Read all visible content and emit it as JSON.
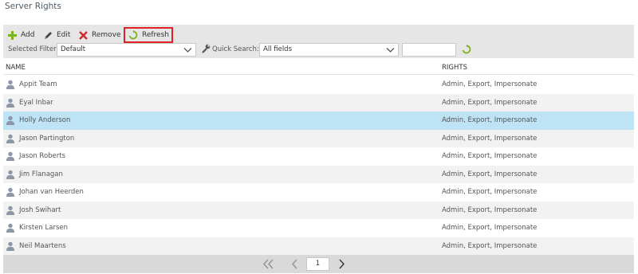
{
  "page_title": "Server Rights",
  "toolbar": {
    "add_label": "Add",
    "edit_label": "Edit",
    "remove_label": "Remove",
    "refresh_label": "Refresh",
    "selected_filter_label": "Selected Filter:",
    "selected_filter_value": "Default",
    "quick_search_label": "Quick Search:",
    "quick_search_field": "All fields",
    "quick_search_text": ""
  },
  "grid": {
    "columns": [
      "NAME",
      "RIGHTS"
    ],
    "rows": [
      {
        "name": "Appit Team",
        "rights": "Admin, Export, Impersonate"
      },
      {
        "name": "Eyal Inbar",
        "rights": "Admin, Export, Impersonate"
      },
      {
        "name": "Holly Anderson",
        "rights": "Admin, Export, Impersonate"
      },
      {
        "name": "Jason Partington",
        "rights": "Admin, Export, Impersonate"
      },
      {
        "name": "Jason Roberts",
        "rights": "Admin, Export, Impersonate"
      },
      {
        "name": "Jim Flanagan",
        "rights": "Admin, Export, Impersonate"
      },
      {
        "name": "Johan van Heerden",
        "rights": "Admin, Export, Impersonate"
      },
      {
        "name": "Josh Swihart",
        "rights": "Admin, Export, Impersonate"
      },
      {
        "name": "Kirsten Larsen",
        "rights": "Admin, Export, Impersonate"
      },
      {
        "name": "Neil Maartens",
        "rights": "Admin, Export, Impersonate"
      }
    ],
    "selected_row": 2
  },
  "pager": {
    "current_page": "1"
  },
  "icons": {
    "add": "plus-icon",
    "edit": "pencil-icon",
    "remove": "x-icon",
    "refresh": "refresh-icon",
    "quick_search": "wrench-icon",
    "user": "user-icon"
  },
  "colors": {
    "toolbar_bg": "#e6e6e6",
    "selected_row": "#bde3f5",
    "alt_row": "#f2f2f2",
    "refresh_highlight": "#e32027",
    "add_green": "#7cb518",
    "remove_red": "#d4262d"
  }
}
